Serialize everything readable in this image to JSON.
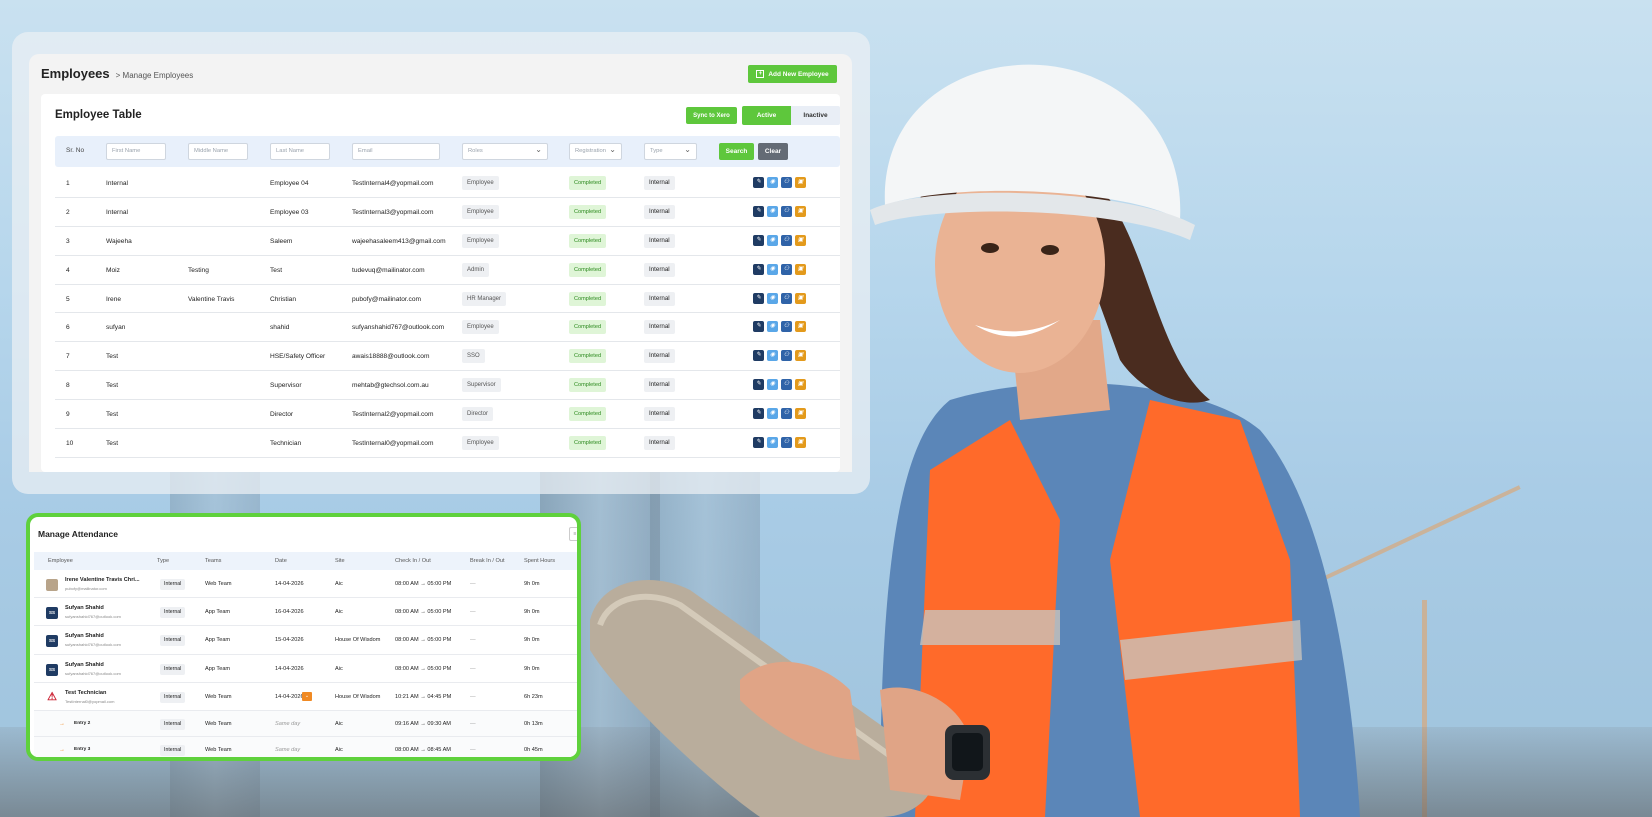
{
  "employees": {
    "title": "Employees",
    "breadcrumb": "> Manage Employees",
    "add_button": "Add New Employee",
    "table_title": "Employee Table",
    "sync_button": "Sync to Xero",
    "toggle_active": "Active",
    "toggle_inactive": "Inactive",
    "filters": {
      "sr_label": "Sr. No",
      "first_name": "First Name",
      "middle_name": "Middle Name",
      "last_name": "Last Name",
      "email": "Email",
      "roles": "Roles",
      "registration": "Registration",
      "type": "Type",
      "search": "Search",
      "clear": "Clear"
    },
    "rows": [
      {
        "no": "1",
        "first": "Internal",
        "middle": "",
        "last": "Employee 04",
        "email": "TestInternal4@yopmail.com",
        "role": "Employee",
        "reg": "Completed",
        "type": "Internal"
      },
      {
        "no": "2",
        "first": "Internal",
        "middle": "",
        "last": "Employee 03",
        "email": "TestInternal3@yopmail.com",
        "role": "Employee",
        "reg": "Completed",
        "type": "Internal"
      },
      {
        "no": "3",
        "first": "Wajeeha",
        "middle": "",
        "last": "Saleem",
        "email": "wajeehasaleem413@gmail.com",
        "role": "Employee",
        "reg": "Completed",
        "type": "Internal"
      },
      {
        "no": "4",
        "first": "Moiz",
        "middle": "Testing",
        "last": "Test",
        "email": "tudevuq@mailinator.com",
        "role": "Admin",
        "reg": "Completed",
        "type": "Internal"
      },
      {
        "no": "5",
        "first": "Irene",
        "middle": "Valentine Travis",
        "last": "Christian",
        "email": "pubofy@mailinator.com",
        "role": "HR Manager",
        "reg": "Completed",
        "type": "Internal"
      },
      {
        "no": "6",
        "first": "sufyan",
        "middle": "",
        "last": "shahid",
        "email": "sufyanshahid767@outlook.com",
        "role": "Employee",
        "reg": "Completed",
        "type": "Internal"
      },
      {
        "no": "7",
        "first": "Test",
        "middle": "",
        "last": "HSE/Safety Officer",
        "email": "awais18888@outlook.com",
        "role": "SSO",
        "reg": "Completed",
        "type": "Internal"
      },
      {
        "no": "8",
        "first": "Test",
        "middle": "",
        "last": "Supervisor",
        "email": "mehtab@gtechsol.com.au",
        "role": "Supervisor",
        "reg": "Completed",
        "type": "Internal"
      },
      {
        "no": "9",
        "first": "Test",
        "middle": "",
        "last": "Director",
        "email": "TestInternal2@yopmail.com",
        "role": "Director",
        "reg": "Completed",
        "type": "Internal"
      },
      {
        "no": "10",
        "first": "Test",
        "middle": "",
        "last": "Technician",
        "email": "TestInternal0@yopmail.com",
        "role": "Employee",
        "reg": "Completed",
        "type": "Internal"
      }
    ]
  },
  "attendance": {
    "title": "Manage Attendance",
    "headers": {
      "employee": "Employee",
      "type": "Type",
      "teams": "Teams",
      "date": "Date",
      "site": "Site",
      "check": "Check In / Out",
      "break": "Break In / Out",
      "spent": "Spent Hours"
    },
    "rows": [
      {
        "name": "Irene Valentine Travis Chri...",
        "email": "pubofy@mailinator.com",
        "avatar": "",
        "type": "Internal",
        "team": "Web Team",
        "date": "14-04-2026",
        "site": "Aic",
        "check": "08:00 AM → 05:00 PM",
        "brk": "—",
        "spent": "9h 0m"
      },
      {
        "name": "Sufyan Shahid",
        "email": "sufyanshahid767@outlook.com",
        "avatar": "SS",
        "type": "Internal",
        "team": "App Team",
        "date": "16-04-2026",
        "site": "Aic",
        "check": "08:00 AM → 05:00 PM",
        "brk": "—",
        "spent": "9h 0m"
      },
      {
        "name": "Sufyan Shahid",
        "email": "sufyanshahid767@outlook.com",
        "avatar": "SS",
        "type": "Internal",
        "team": "App Team",
        "date": "15-04-2026",
        "site": "House Of Wisdom",
        "check": "08:00 AM → 05:00 PM",
        "brk": "—",
        "spent": "9h 0m"
      },
      {
        "name": "Sufyan Shahid",
        "email": "sufyanshahid767@outlook.com",
        "avatar": "SS",
        "type": "Internal",
        "team": "App Team",
        "date": "14-04-2026",
        "site": "Aic",
        "check": "08:00 AM → 05:00 PM",
        "brk": "—",
        "spent": "9h 0m"
      },
      {
        "name": "Test Technician",
        "email": "TestInternal0@yopmail.com",
        "avatar": "",
        "type": "Internal",
        "team": "Web Team",
        "date": "14-04-2026",
        "site": "House Of Wisdom",
        "check": "10:21 AM → 04:45 PM",
        "brk": "—",
        "spent": "6h 23m"
      }
    ],
    "sub_rows": [
      {
        "name": "Entry 2",
        "type": "Internal",
        "team": "Web Team",
        "date": "Same day",
        "site": "Aic",
        "check": "09:16 AM → 09:30 AM",
        "brk": "—",
        "spent": "0h 13m"
      },
      {
        "name": "Entry 3",
        "type": "Internal",
        "team": "Web Team",
        "date": "Same day",
        "site": "Aic",
        "check": "08:00 AM → 08:45 AM",
        "brk": "—",
        "spent": "0h 45m"
      }
    ]
  },
  "colors": {
    "accent_green": "#5ec73c",
    "frame_green": "#5fd13c",
    "orange": "#f08a24",
    "navy": "#1f3b63"
  }
}
